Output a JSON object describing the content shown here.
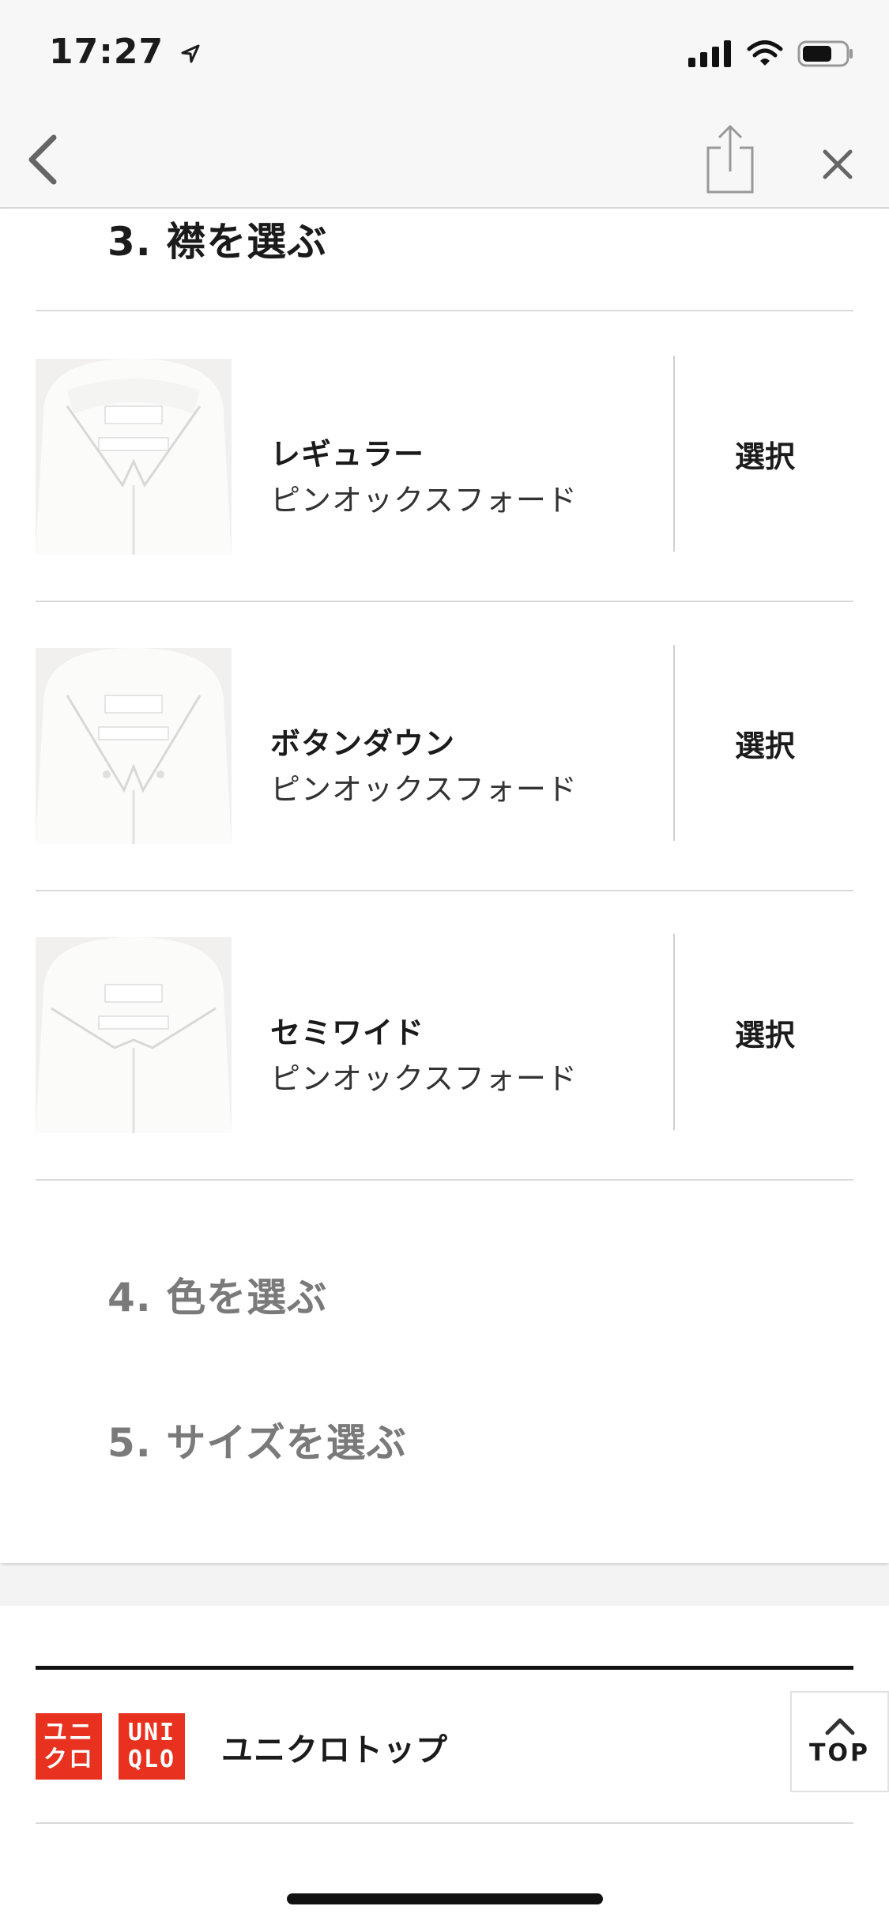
{
  "status_bar": {
    "time": "17:27"
  },
  "steps": {
    "step3": "3. 襟を選ぶ",
    "step4": "4. 色を選ぶ",
    "step5": "5. サイズを選ぶ"
  },
  "collar_options": [
    {
      "name": "レギュラー",
      "fabric": "ピンオックスフォード",
      "select_label": "選択"
    },
    {
      "name": "ボタンダウン",
      "fabric": "ピンオックスフォード",
      "select_label": "選択"
    },
    {
      "name": "セミワイド",
      "fabric": "ピンオックスフォード",
      "select_label": "選択"
    }
  ],
  "footer": {
    "logo_text_1": "ユニクロ",
    "logo_text_2": "UNIQLO",
    "link_label": "ユニクロトップ",
    "top_button_label": "TOP"
  },
  "icons": {
    "back": "chevron-left-icon",
    "share": "share-icon",
    "close": "close-icon",
    "top": "chevron-up-icon"
  },
  "colors": {
    "brand_red": "#e8321f",
    "inactive_step": "#7a7a7a"
  }
}
